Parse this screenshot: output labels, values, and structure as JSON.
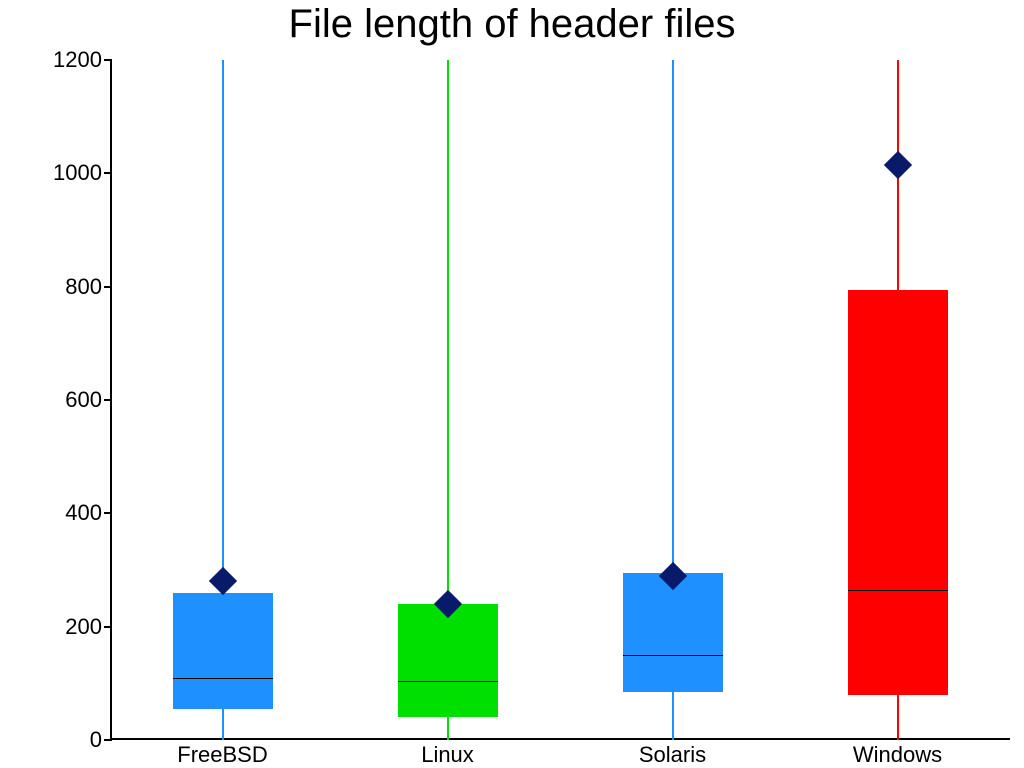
{
  "chart_data": {
    "type": "boxplot",
    "title": "File length of header files",
    "xlabel": "",
    "ylabel": "",
    "ylim": [
      0,
      1200
    ],
    "yticks": [
      0,
      200,
      400,
      600,
      800,
      1000,
      1200
    ],
    "categories": [
      "FreeBSD",
      "Linux",
      "Solaris",
      "Windows"
    ],
    "series": [
      {
        "name": "FreeBSD",
        "color": "#1e90ff",
        "q1": 55,
        "median": 110,
        "q3": 260,
        "mean": 280,
        "whisker_low": 0,
        "whisker_high": 1200
      },
      {
        "name": "Linux",
        "color": "#00e000",
        "q1": 40,
        "median": 105,
        "q3": 240,
        "mean": 240,
        "whisker_low": 0,
        "whisker_high": 1200
      },
      {
        "name": "Solaris",
        "color": "#1e90ff",
        "q1": 85,
        "median": 150,
        "q3": 295,
        "mean": 290,
        "whisker_low": 0,
        "whisker_high": 1200
      },
      {
        "name": "Windows",
        "color": "#ff0000",
        "q1": 80,
        "median": 265,
        "q3": 795,
        "mean": 1015,
        "whisker_low": 0,
        "whisker_high": 1200
      }
    ]
  }
}
